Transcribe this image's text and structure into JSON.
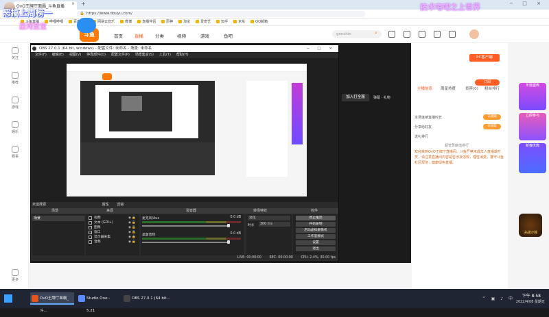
{
  "browser": {
    "tab_title": "OvO王牌厅面霸_斗鱼直播",
    "url": "https://www.douyu.com/",
    "bookmarks": [
      "斗鱼直播",
      "哔哩哔哩",
      "百度一下",
      "网易云音乐",
      "微博",
      "直播伴侣",
      "原神",
      "淘宝",
      "爱奇艺",
      "知乎",
      "京东",
      "QQ邮箱"
    ]
  },
  "overlay": {
    "title": "恶搞上周榜一",
    "subtitle": "星河至宝",
    "right_text": "技术宅吧之上世界"
  },
  "site": {
    "logo": "斗鱼",
    "nav": [
      "首页",
      "直播",
      "分类",
      "视频",
      "游戏",
      "鱼吧"
    ],
    "search_placeholder": "genshin",
    "rail": [
      "关注",
      "推荐",
      "游戏",
      "娱乐",
      "赛事",
      "更多"
    ],
    "pc_client": "PC客户端",
    "follow_label": "订阅",
    "right_tabs": [
      "主播信息",
      "周星热度",
      "贵宾(0)",
      "粉丝排行"
    ],
    "list_rows": [
      "本场连续直播时长",
      "分享给好友",
      "送礼排行"
    ],
    "list_badge": "去领取",
    "rank_title": "超管贡献值排行",
    "notice": "欢迎来到OvO王牌厅直播间。斗鱼严禁未成年人直播或打赏，请注意直播间内容是否涉及违规，理性消费，遵守斗鱼社区规范，健康绿色直播。",
    "promo_labels": [
      "年度盛典",
      "立即参与",
      "新春庆典"
    ],
    "promo_game": "决战沙城",
    "player_btn": "加入打全服",
    "chat_stub": "弹幕 · 礼物"
  },
  "obs": {
    "title": "OBS 27.0.1 (64 bit, windows) - 配置文件: 未命名 - 场景: 未命名",
    "menu": [
      "文件(F)",
      "编辑(E)",
      "视图(V)",
      "停靠部件(D)",
      "配置文件(P)",
      "场景集合(S)",
      "工具(T)",
      "帮助(H)"
    ],
    "dock_labels": [
      "未选择源",
      "属性",
      "滤镜"
    ],
    "dock_heads": [
      "场景",
      "来源",
      "混音器",
      "转场特效",
      "控件"
    ],
    "scenes": [
      "场景"
    ],
    "sources": [
      "视频",
      "文本 (GDI+)",
      "图像",
      "窗口",
      "显示器采集",
      "音频"
    ],
    "mixer": [
      {
        "label": "麦克风/Aux",
        "db": "0.0 dB"
      },
      {
        "label": "桌面音频",
        "db": "0.0 dB"
      }
    ],
    "transition": "淡化",
    "duration_label": "时长",
    "duration": "300 ms",
    "controls": [
      "停止推流",
      "开始录制",
      "启动虚拟摄像机",
      "工作室模式",
      "设置",
      "退出"
    ],
    "status": [
      "LIVE: 00:00:00",
      "REC: 00:00:00",
      "CPU: 2.4%, 30.00 fps"
    ]
  },
  "taskbar": {
    "apps": [
      "OvO王牌厅面霸_斗...",
      "Studio One - 5.21",
      "OBS 27.0.1 (64 bit..."
    ],
    "time": "下午 8:58",
    "date": "2022/4/08 星期五"
  }
}
